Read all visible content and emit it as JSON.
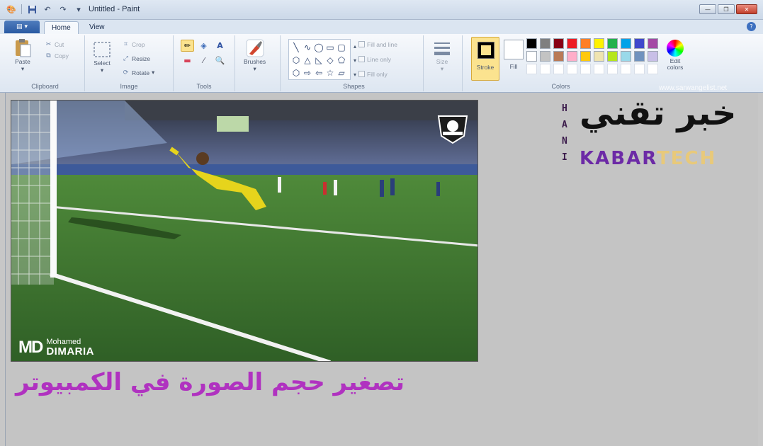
{
  "window": {
    "title": "Untitled - Paint"
  },
  "tabs": [
    {
      "label": "Home"
    },
    {
      "label": "View"
    }
  ],
  "ribbon": {
    "clipboard": {
      "label": "Clipboard",
      "paste": "Paste",
      "cut": "Cut",
      "copy": "Copy"
    },
    "image": {
      "label": "Image",
      "select": "Select",
      "crop": "Crop",
      "resize": "Resize",
      "rotate": "Rotate"
    },
    "tools": {
      "label": "Tools"
    },
    "brushes": {
      "label": "Brushes"
    },
    "shapes": {
      "label": "Shapes",
      "fill_and_line": "Fill and line",
      "line_only": "Line only",
      "fill_only": "Fill only"
    },
    "size": {
      "label": "Size"
    },
    "colors": {
      "label": "Colors",
      "stroke": "Stroke",
      "fill": "Fill",
      "edit_colors": "Edit colors",
      "palette_row1": [
        "#000000",
        "#7f7f7f",
        "#880015",
        "#ed1c24",
        "#ff7f27",
        "#fff200",
        "#22b14c",
        "#00a2e8",
        "#3f48cc",
        "#a349a4"
      ],
      "palette_row2": [
        "#ffffff",
        "#c3c3c3",
        "#b97a57",
        "#ffaec9",
        "#ffc90e",
        "#efe4b0",
        "#b5e61d",
        "#99d9ea",
        "#7092be",
        "#c8bfe7"
      ]
    }
  },
  "canvas": {
    "watermark": "www.sarwangelist.net",
    "brand_arabic": "خبر تقني",
    "brand_hani": [
      "H",
      "A",
      "N",
      "I"
    ],
    "brand_kabar": "KABAR",
    "brand_tech": "TECH",
    "caption": "تصغير حجم الصورة في الكمبيوتر",
    "photo_logo": {
      "mark": "MD",
      "line1": "Mohamed",
      "line2": "DIMARIA"
    },
    "badge_text": "MOHAMED DIMARIA"
  }
}
